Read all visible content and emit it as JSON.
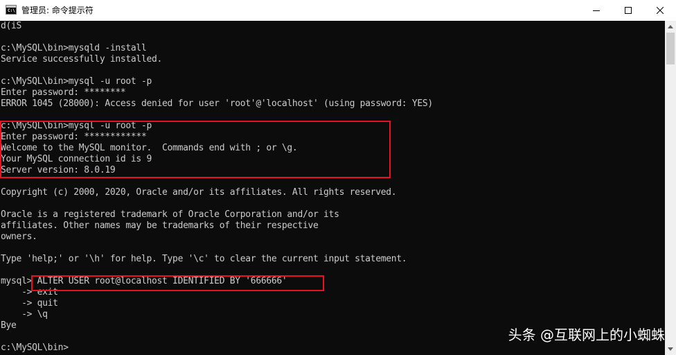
{
  "window": {
    "title": "管理员: 命令提示符",
    "icon": "console-app-icon",
    "controls": [
      "minimize-icon",
      "maximize-icon",
      "close-icon"
    ]
  },
  "console": {
    "lines": [
      "d(iS",
      "",
      "c:\\MySQL\\bin>mysqld -install",
      "Service successfully installed.",
      "",
      "c:\\MySQL\\bin>mysql -u root -p",
      "Enter password: ********",
      "ERROR 1045 (28000): Access denied for user 'root'@'localhost' (using password: YES)",
      "",
      "c:\\MySQL\\bin>mysql -u root -p",
      "Enter password: ************",
      "Welcome to the MySQL monitor.  Commands end with ; or \\g.",
      "Your MySQL connection id is 9",
      "Server version: 8.0.19",
      "",
      "Copyright (c) 2000, 2020, Oracle and/or its affiliates. All rights reserved.",
      "",
      "Oracle is a registered trademark of Oracle Corporation and/or its",
      "affiliates. Other names may be trademarks of their respective",
      "owners.",
      "",
      "Type 'help;' or '\\h' for help. Type '\\c' to clear the current input statement.",
      "",
      "mysql> ALTER USER root@localhost IDENTIFIED BY '666666'",
      "    -> exit",
      "    -> quit",
      "    -> \\q",
      "Bye",
      "",
      "c:\\MySQL\\bin>"
    ]
  },
  "annotations": {
    "highlight_color": "#e81123"
  },
  "watermark": {
    "text": "头条 @互联网上的小蜘蛛"
  },
  "colors": {
    "console_bg": "#0c0c0c",
    "console_fg": "#cccccc",
    "titlebar_bg": "#ffffff"
  }
}
